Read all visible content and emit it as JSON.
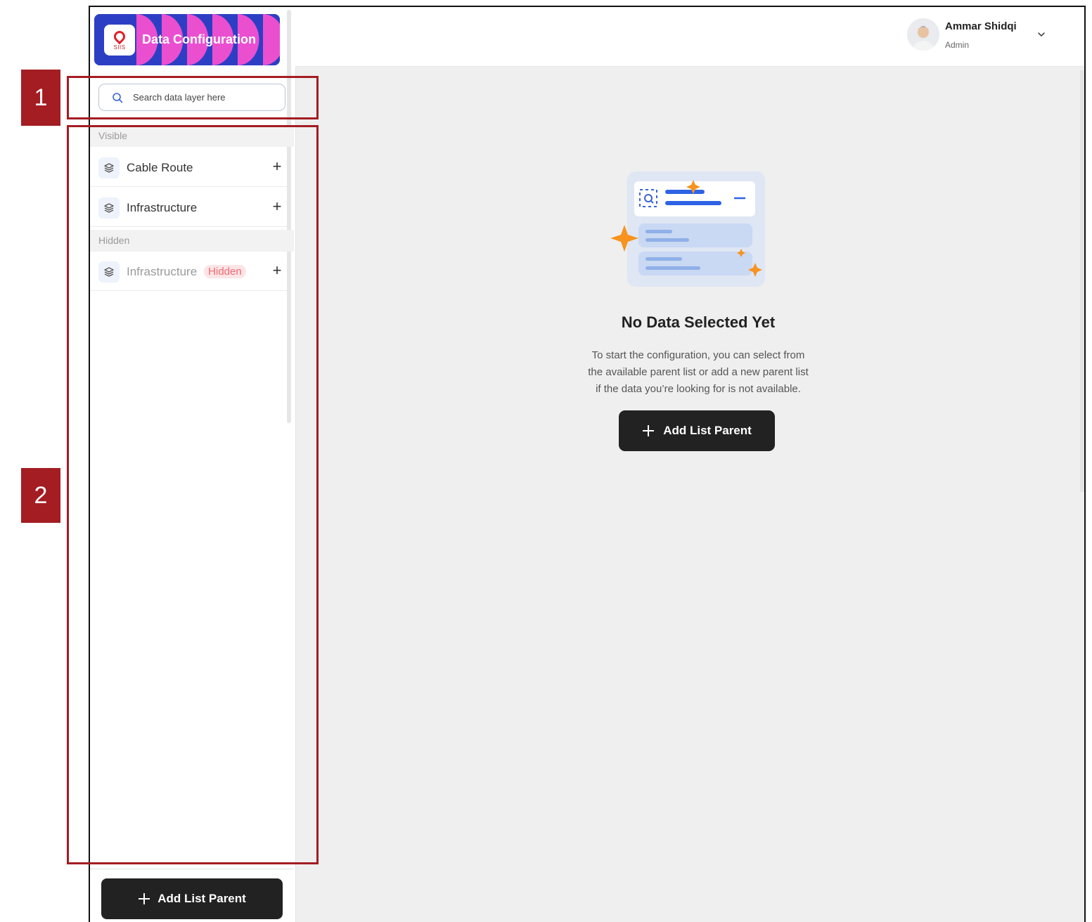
{
  "app": {
    "logo_sub": "SIIS",
    "title": "Data Configuration"
  },
  "search": {
    "placeholder": "Search data layer here"
  },
  "sections": {
    "visible_label": "Visible",
    "hidden_label": "Hidden"
  },
  "layers": {
    "visible": [
      {
        "label": "Cable Route"
      },
      {
        "label": "Infrastructure"
      }
    ],
    "hidden": [
      {
        "label": "Infrastructure",
        "badge": "Hidden"
      }
    ]
  },
  "sidebar": {
    "add_button_label": "Add List Parent"
  },
  "user": {
    "name": "Ammar Shidqi",
    "role": "Admin"
  },
  "empty_state": {
    "title": "No Data Selected Yet",
    "description_lines": [
      "To start the configuration, you can select from",
      "the available parent list or add a new parent list",
      "if the data you’re looking for is not available."
    ],
    "button_label": "Add List Parent"
  },
  "annotations": [
    {
      "number": "1"
    },
    {
      "number": "2"
    }
  ],
  "colors": {
    "accent_dark": "#222222",
    "annotation_red": "#a31d22",
    "logo_blue": "#2c3fc4",
    "logo_pink": "#ea4fd0",
    "sparkle_orange": "#f7931e"
  }
}
